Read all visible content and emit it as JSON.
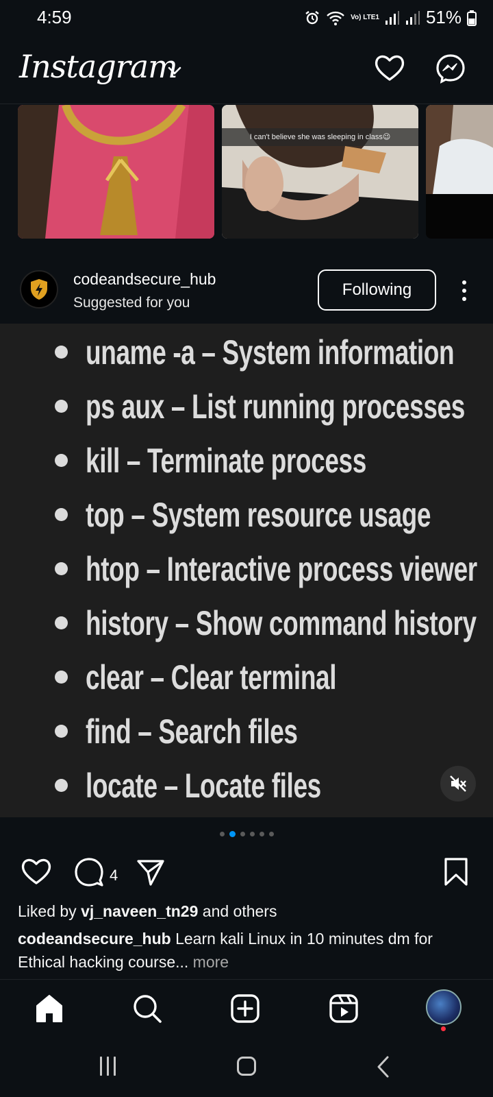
{
  "status_bar": {
    "time": "4:59",
    "lte_label": "Vo) LTE1",
    "battery_percent": "51%"
  },
  "header": {
    "logo_text": "Instagram"
  },
  "reels": [
    {
      "caption": ""
    },
    {
      "caption": "I can't believe she was sleeping in class😉"
    },
    {
      "caption": ""
    }
  ],
  "post": {
    "username": "codeandsecure_hub",
    "subtitle": "Suggested for you",
    "follow_label": "Following",
    "commands": [
      "uname -a – System information",
      "ps aux – List running processes",
      "kill – Terminate process",
      "top – System resource usage",
      "htop – Interactive process viewer",
      "history – Show command history",
      "clear – Clear terminal",
      "find – Search files",
      "locate – Locate files"
    ],
    "carousel": {
      "count": 6,
      "active_index": 1
    },
    "comment_count": "4",
    "likes": {
      "prefix": "Liked by ",
      "user": "vj_naveen_tn29",
      "suffix": " and others"
    },
    "caption": {
      "username": "codeandsecure_hub",
      "text": " Learn kali Linux in 10 minutes dm for Ethical hacking course",
      "ellipsis": "...",
      "more": " more"
    }
  },
  "colors": {
    "background": "#0c1014",
    "media_background": "#1e1e1e",
    "accent": "#0095f6",
    "notification": "#ff3040"
  }
}
